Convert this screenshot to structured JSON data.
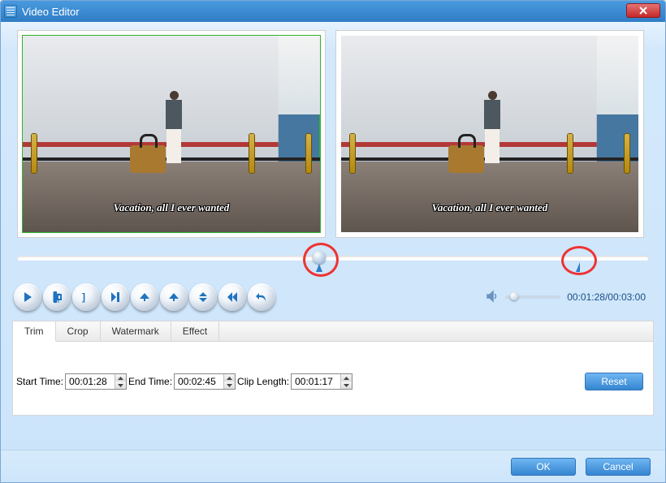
{
  "window": {
    "title": "Video Editor"
  },
  "preview": {
    "left_caption": "Vacation, all I ever wanted",
    "right_caption": "Vacation, all I ever wanted"
  },
  "time": {
    "current": "00:01:28",
    "total": "00:03:00"
  },
  "tabs": {
    "trim": "Trim",
    "crop": "Crop",
    "watermark": "Watermark",
    "effect": "Effect"
  },
  "trim": {
    "start_label": "Start Time:",
    "start_value": "00:01:28",
    "end_label": "End Time:",
    "end_value": "00:02:45",
    "clip_label": "Clip Length:",
    "clip_value": "00:01:17",
    "reset": "Reset"
  },
  "footer": {
    "ok": "OK",
    "cancel": "Cancel"
  }
}
